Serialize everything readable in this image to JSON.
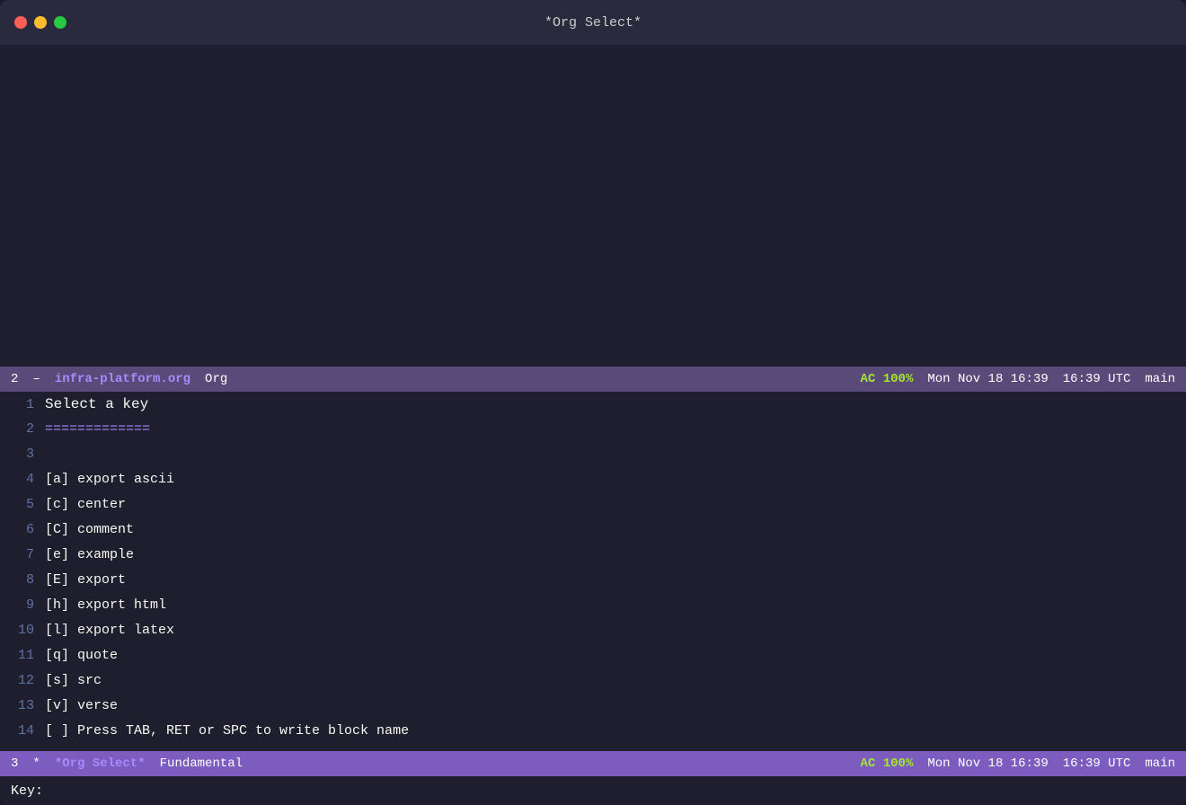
{
  "titlebar": {
    "title": "*Org Select*"
  },
  "modeline1": {
    "buffer_num": "2",
    "dash": "–",
    "filename": "infra-platform.org",
    "mode": "Org",
    "ac": "AC 100%",
    "datetime": "Mon Nov 18 16:39",
    "utc": "16:39 UTC",
    "branch": "main"
  },
  "content": {
    "lines": [
      {
        "num": "1",
        "text": "Select a key"
      },
      {
        "num": "2",
        "text": "============="
      },
      {
        "num": "3",
        "text": ""
      },
      {
        "num": "4",
        "text": "[a]       export ascii"
      },
      {
        "num": "5",
        "text": "[c]       center"
      },
      {
        "num": "6",
        "text": "[C]       comment"
      },
      {
        "num": "7",
        "text": "[e]       example"
      },
      {
        "num": "8",
        "text": "[E]       export"
      },
      {
        "num": "9",
        "text": "[h]       export html"
      },
      {
        "num": "10",
        "text": "[l]       export latex"
      },
      {
        "num": "11",
        "text": "[q]       quote"
      },
      {
        "num": "12",
        "text": "[s]       src"
      },
      {
        "num": "13",
        "text": "[v]       verse"
      },
      {
        "num": "14",
        "text": "[        ]       Press TAB, RET or SPC to write block name"
      }
    ]
  },
  "modeline2": {
    "buffer_num": "3",
    "star": "*",
    "bufname": "*Org Select*",
    "mode": "Fundamental",
    "ac": "AC 100%",
    "datetime": "Mon Nov 18 16:39",
    "utc": "16:39 UTC",
    "branch": "main"
  },
  "minibuffer": {
    "label": "Key:"
  }
}
